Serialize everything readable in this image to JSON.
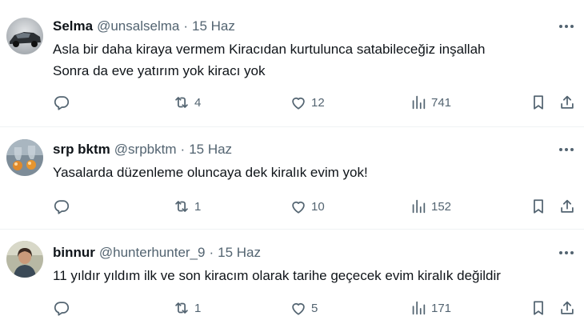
{
  "tweets": [
    {
      "name": "Selma",
      "handle": "@unsalselma",
      "separator": "·",
      "date": "15 Haz",
      "text_lines": [
        "Asla bir daha kiraya vermem Kiracıdan kurtulunca satabileceğiz inşallah",
        "Sonra da eve yatırım yok kiracı yok"
      ],
      "retweets": "4",
      "likes": "12",
      "views": "741",
      "avatar": "car-avatar"
    },
    {
      "name": "srp bktm",
      "handle": "@srpbktm",
      "separator": "·",
      "date": "15 Haz",
      "text_lines": [
        "Yasalarda düzenleme oluncaya dek kiralık evim yok!"
      ],
      "retweets": "1",
      "likes": "10",
      "views": "152",
      "avatar": "glass-drops-avatar"
    },
    {
      "name": "binnur",
      "handle": "@hunterhunter_9",
      "separator": "·",
      "date": "15 Haz",
      "text_lines": [
        "11 yıldır yıldım ilk ve son kiracım olarak tarihe geçecek evim kiralık değildir"
      ],
      "retweets": "1",
      "likes": "5",
      "views": "171",
      "avatar": "person-avatar"
    }
  ],
  "icons": {
    "reply": "reply-icon",
    "retweet": "retweet-icon",
    "like": "heart-icon",
    "views": "views-icon",
    "bookmark": "bookmark-icon",
    "share": "share-icon",
    "more": "more-icon"
  },
  "colors": {
    "text": "#0f1419",
    "secondary": "#536471",
    "divider": "#eff3f4"
  }
}
